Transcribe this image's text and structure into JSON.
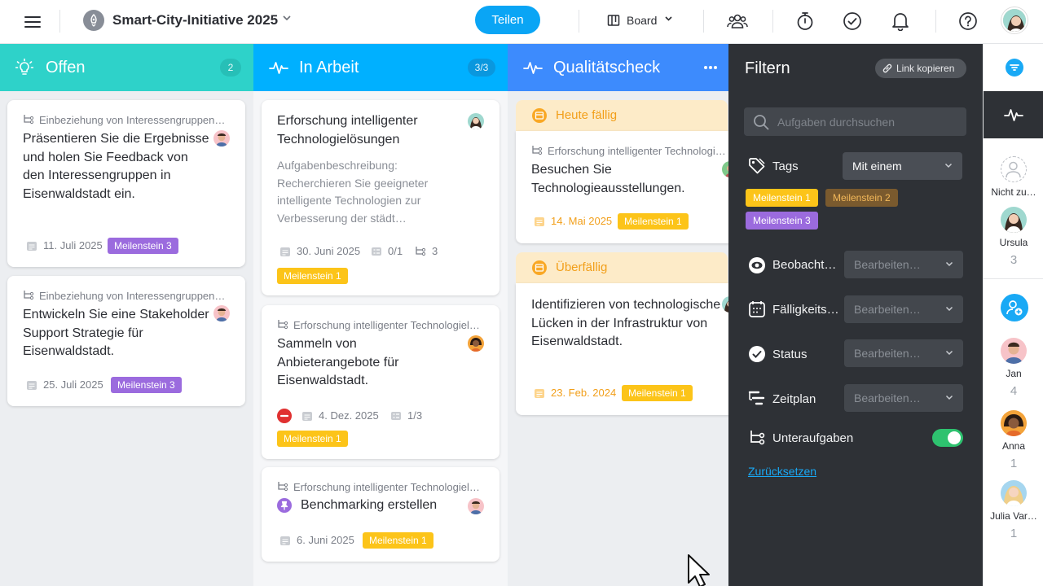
{
  "topbar": {
    "project_title": "Smart-City-Initiative 2025",
    "share_label": "Teilen",
    "view_label": "Board"
  },
  "icons": [
    "menu-icon",
    "project-logo-icon",
    "chevron-down-icon",
    "board-icon",
    "team-icon",
    "timer-icon",
    "check-circle-icon",
    "bell-icon",
    "help-icon",
    "filter-icon",
    "activity-icon",
    "add-user-icon",
    "calendar-icon",
    "subtask-icon",
    "checklist-icon",
    "pin-icon",
    "cursor-icon"
  ],
  "columns": [
    {
      "name": "Offen",
      "count": "2",
      "color": "#2ed2c9",
      "cards": [
        {
          "parent": "Einbeziehung von Interessengruppen i…",
          "title": "Präsentieren Sie die Ergebnisse und holen Sie Feedback von den Interessengruppen in Eisenwaldstadt ein.",
          "date": "11. Juli 2025",
          "tag": "Meilenstein 3"
        },
        {
          "parent": "Einbeziehung von Interessengruppen i…",
          "title": "Entwickeln Sie eine Stakeholder Support Strategie für Eisenwaldstadt.",
          "date": "25. Juli 2025",
          "tag": "Meilenstein 3"
        }
      ]
    },
    {
      "name": "In Arbeit",
      "count": "3/3",
      "color": "#00b0ff",
      "cards": [
        {
          "title": "Erforschung intelligenter Technologielösungen",
          "desc_label": "Aufgabenbeschreibung:",
          "desc": "Recherchieren Sie geeigneter intelligente Technologien zur Verbesserung der städt…",
          "date": "30. Juni 2025",
          "checklist": "0/1",
          "subtasks": "3",
          "tag": "Meilenstein 1"
        },
        {
          "parent": "Erforschung intelligenter Technologielö…",
          "title": "Sammeln von Anbieterangebote für Eisenwaldstadt.",
          "date": "4. Dez. 2025",
          "checklist": "1/3",
          "tag": "Meilenstein 1"
        },
        {
          "parent": "Erforschung intelligenter Technologielö…",
          "title": "Benchmarking erstellen",
          "date": "6. Juni 2025",
          "tag": "Meilenstein 1"
        }
      ]
    },
    {
      "name": "Qualitätscheck",
      "color": "#3d8bfd",
      "sections": [
        {
          "label": "Heute fällig",
          "cards": [
            {
              "parent": "Erforschung intelligenter Technologielö",
              "title": "Besuchen Sie Technologieausstellungen.",
              "date": "14. Mai 2025",
              "tag": "Meilenstein 1"
            }
          ]
        },
        {
          "label": "Überfällig",
          "cards": [
            {
              "title": "Identifizieren von technologische Lücken in der Infrastruktur von Eisenwaldstadt.",
              "date": "23. Feb. 2024",
              "tag": "Meilenstein 1"
            }
          ]
        }
      ]
    }
  ],
  "filter": {
    "title": "Filtern",
    "copy_link": "Link kopieren",
    "search_placeholder": "Aufgaben durchsuchen",
    "tags_label": "Tags",
    "tags_mode": "Mit einem",
    "selected_tags": [
      "Meilenstein 1",
      "Meilenstein 2",
      "Meilenstein 3"
    ],
    "rows": [
      {
        "label": "Beobacht…",
        "value": "Bearbeiten…"
      },
      {
        "label": "Fälligkeits…",
        "value": "Bearbeiten…"
      },
      {
        "label": "Status",
        "value": "Bearbeiten…"
      },
      {
        "label": "Zeitplan",
        "value": "Bearbeiten…"
      }
    ],
    "subtasks_label": "Unteraufgaben",
    "subtasks_on": true,
    "reset": "Zurücksetzen"
  },
  "sidebar": {
    "unassigned": "Nicht zu…",
    "people": [
      {
        "name": "Ursula",
        "count": "3"
      },
      {
        "name": "Jan",
        "count": "4"
      },
      {
        "name": "Anna",
        "count": "1"
      },
      {
        "name": "Julia Var…",
        "count": "1"
      }
    ]
  }
}
